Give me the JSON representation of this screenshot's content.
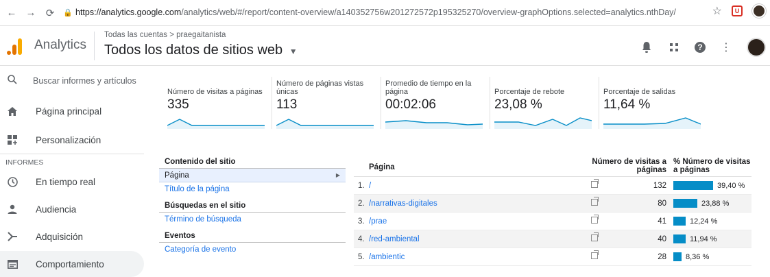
{
  "browser": {
    "url_host": "https://analytics.google.com",
    "url_path": "/analytics/web/#/report/content-overview/a140352756w201272572p195325270/overview-graphOptions.selected=analytics.nthDay/"
  },
  "header": {
    "app_name": "Analytics",
    "breadcrumb": "Todas las cuentas > praegaitanista",
    "property": "Todos los datos de sitios web"
  },
  "sidebar": {
    "search_label": "Buscar informes y artículos",
    "items": [
      {
        "label": "Página principal",
        "icon": "home-icon"
      },
      {
        "label": "Personalización",
        "icon": "customization-icon"
      }
    ],
    "section_label": "INFORMES",
    "reports": [
      {
        "label": "En tiempo real",
        "icon": "clock-icon"
      },
      {
        "label": "Audiencia",
        "icon": "person-icon"
      },
      {
        "label": "Adquisición",
        "icon": "acquisition-icon"
      },
      {
        "label": "Comportamiento",
        "icon": "behavior-icon"
      }
    ]
  },
  "metrics": [
    {
      "label": "Número de visitas a páginas",
      "value": "335"
    },
    {
      "label": "Número de páginas vistas únicas",
      "value": "113"
    },
    {
      "label": "Promedio de tiempo en la página",
      "value": "00:02:06"
    },
    {
      "label": "Porcentaje de rebote",
      "value": "23,08 %"
    },
    {
      "label": "Porcentaje de salidas",
      "value": "11,64 %"
    }
  ],
  "content_nav": {
    "site_content_heading": "Contenido del sitio",
    "page_item": "Página",
    "page_title_item": "Título de la página",
    "site_search_heading": "Búsquedas en el sitio",
    "search_term_item": "Término de búsqueda",
    "events_heading": "Eventos",
    "event_category_item": "Categoría de evento"
  },
  "table": {
    "col_page": "Página",
    "col_visits": "Número de visitas a páginas",
    "col_pct": "% Número de visitas a páginas",
    "rows": [
      {
        "rank": "1.",
        "path": "/",
        "visits": "132",
        "pct": "39,40 %",
        "share": 39.4
      },
      {
        "rank": "2.",
        "path": "/narrativas-digitales",
        "visits": "80",
        "pct": "23,88 %",
        "share": 23.88
      },
      {
        "rank": "3.",
        "path": "/prae",
        "visits": "41",
        "pct": "12,24 %",
        "share": 12.24
      },
      {
        "rank": "4.",
        "path": "/red-ambiental",
        "visits": "40",
        "pct": "11,94 %",
        "share": 11.94
      },
      {
        "rank": "5.",
        "path": "/ambientic",
        "visits": "28",
        "pct": "8,36 %",
        "share": 8.36
      }
    ]
  },
  "colors": {
    "accent": "#058dc7",
    "sparkline": "#058dc7",
    "link": "#1a73e8"
  }
}
